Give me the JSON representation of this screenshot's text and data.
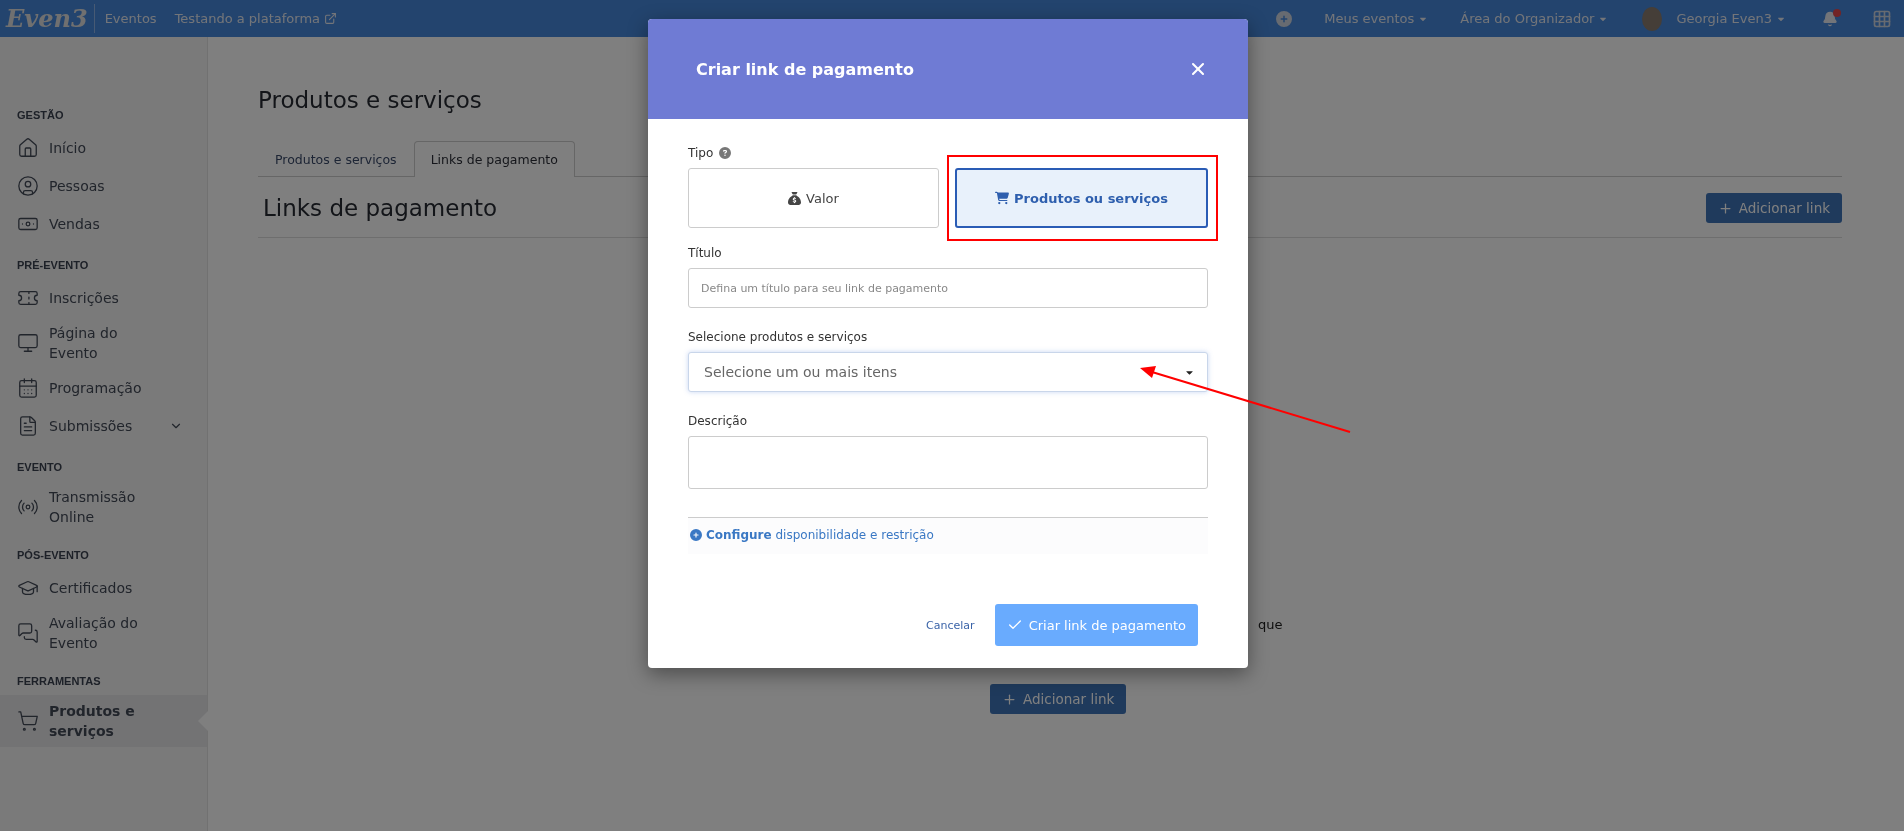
{
  "topbar": {
    "logo": "Even3",
    "section": "Eventos",
    "event_link": "Testando a plataforma",
    "menus": [
      "Meus eventos",
      "Área do Organizador"
    ],
    "user": "Georgia Even3",
    "notifications_unread": true
  },
  "sidebar": {
    "sections": [
      {
        "title": "GESTÃO",
        "items": [
          {
            "label": "Início",
            "kind": "link",
            "selected": false
          },
          {
            "label": "Pessoas",
            "kind": "link",
            "selected": false
          },
          {
            "label": "Vendas",
            "kind": "link",
            "selected": false
          }
        ]
      },
      {
        "title": "PRÉ-EVENTO",
        "items": [
          {
            "label": "Inscrições",
            "kind": "link",
            "selected": false
          },
          {
            "label": "Página do Evento",
            "kind": "link",
            "selected": false
          },
          {
            "label": "Programação",
            "kind": "link",
            "selected": false
          },
          {
            "label": "Submissões",
            "kind": "group",
            "selected": false
          }
        ]
      },
      {
        "title": "EVENTO",
        "items": [
          {
            "label": "Transmissão Online",
            "kind": "link",
            "selected": false
          }
        ]
      },
      {
        "title": "PÓS-EVENTO",
        "items": [
          {
            "label": "Certificados",
            "kind": "link",
            "selected": false
          },
          {
            "label": "Avaliação do Evento",
            "kind": "link",
            "selected": false
          }
        ]
      },
      {
        "title": "FERRAMENTAS",
        "items": [
          {
            "label": "Produtos e serviços",
            "kind": "link",
            "selected": true
          }
        ]
      }
    ]
  },
  "page": {
    "title": "Produtos e serviços",
    "tabs": [
      {
        "label": "Produtos e serviços",
        "selected": false
      },
      {
        "label": "Links de pagamento",
        "selected": true
      }
    ],
    "section_title": "Links de pagamento",
    "add_button": "Adicionar link",
    "empty_text": "que",
    "empty_button": "Adicionar link"
  },
  "modal": {
    "title": "Criar link de pagamento",
    "type_label": "Tipo",
    "type_options": [
      {
        "label": "Valor",
        "kind": "amount",
        "selected": false
      },
      {
        "label": "Produtos ou serviços",
        "kind": "products",
        "selected": true
      }
    ],
    "title_field": {
      "label": "Título",
      "placeholder": "Defina um título para seu link de pagamento"
    },
    "products_field": {
      "label": "Selecione produtos e serviços",
      "placeholder": "Selecione um ou mais itens"
    },
    "description_field": {
      "label": "Descrição"
    },
    "configure": "**Configure** disponibilidade e restrição",
    "cancel": "Cancelar",
    "submit": "Criar link de pagamento"
  }
}
